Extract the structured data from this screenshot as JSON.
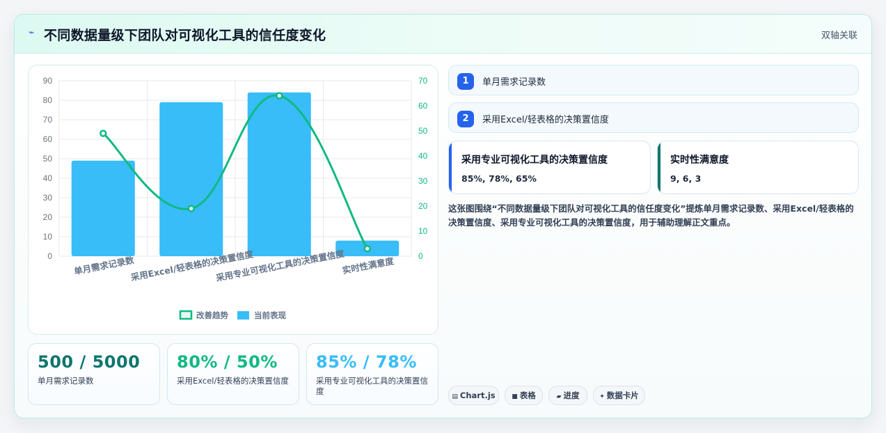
{
  "header": {
    "icon": "trend-icon",
    "title": "不同数据量级下团队对可视化工具的信任度变化",
    "tag": "双轴关联"
  },
  "chart_data": {
    "type": "bar",
    "categories": [
      "单月需求记录数",
      "采用Excel/轻表格的决策置信度",
      "采用专业可视化工具的决策置信度",
      "实时性满意度"
    ],
    "series": [
      {
        "name": "当前表现",
        "type": "bar",
        "axis": "left",
        "values": [
          49,
          79,
          84,
          8
        ],
        "color": "#38bdf8"
      },
      {
        "name": "改善趋势",
        "type": "line",
        "axis": "right",
        "values": [
          49,
          19,
          64,
          3
        ],
        "color": "#10b981"
      }
    ],
    "y_left": {
      "min": 0,
      "max": 90,
      "ticks": [
        0,
        10,
        20,
        30,
        40,
        50,
        60,
        70,
        80,
        90
      ]
    },
    "y_right": {
      "min": 0,
      "max": 70,
      "ticks": [
        0,
        10,
        20,
        30,
        40,
        50,
        60,
        70
      ]
    },
    "legend": [
      "改善趋势",
      "当前表现"
    ],
    "legend_position": "bottom",
    "grid": true
  },
  "stats": [
    {
      "value": "500 / 5000",
      "label": "单月需求记录数",
      "color": "#0f766e"
    },
    {
      "value": "80% / 50%",
      "label": "采用Excel/轻表格的决策置信度",
      "color": "#10b981"
    },
    {
      "value": "85% / 78%",
      "label": "采用专业可视化工具的决策置信度",
      "color": "#38bdf8"
    }
  ],
  "list": [
    {
      "num": "1",
      "text": "单月需求记录数"
    },
    {
      "num": "2",
      "text": "采用Excel/轻表格的决策置信度"
    }
  ],
  "cards": [
    {
      "title": "采用专业可视化工具的决策置信度",
      "value": "85%, 78%, 65%",
      "accent": "#2563eb"
    },
    {
      "title": "实时性满意度",
      "value": "9, 6, 3",
      "accent": "#0f766e"
    }
  ],
  "description": "这张图围绕“不同数据量级下团队对可视化工具的信任度变化”提炼单月需求记录数、采用Excel/轻表格的决策置信度、采用专业可视化工具的决策置信度，用于辅助理解正文重点。",
  "chips": [
    {
      "icon": "chart-icon",
      "glyph": "▤",
      "label": "Chart.js"
    },
    {
      "icon": "table-icon",
      "glyph": "■",
      "label": "表格"
    },
    {
      "icon": "progress-icon",
      "glyph": "▰",
      "label": "进度"
    },
    {
      "icon": "card-icon",
      "glyph": "✦",
      "label": "数据卡片"
    }
  ]
}
